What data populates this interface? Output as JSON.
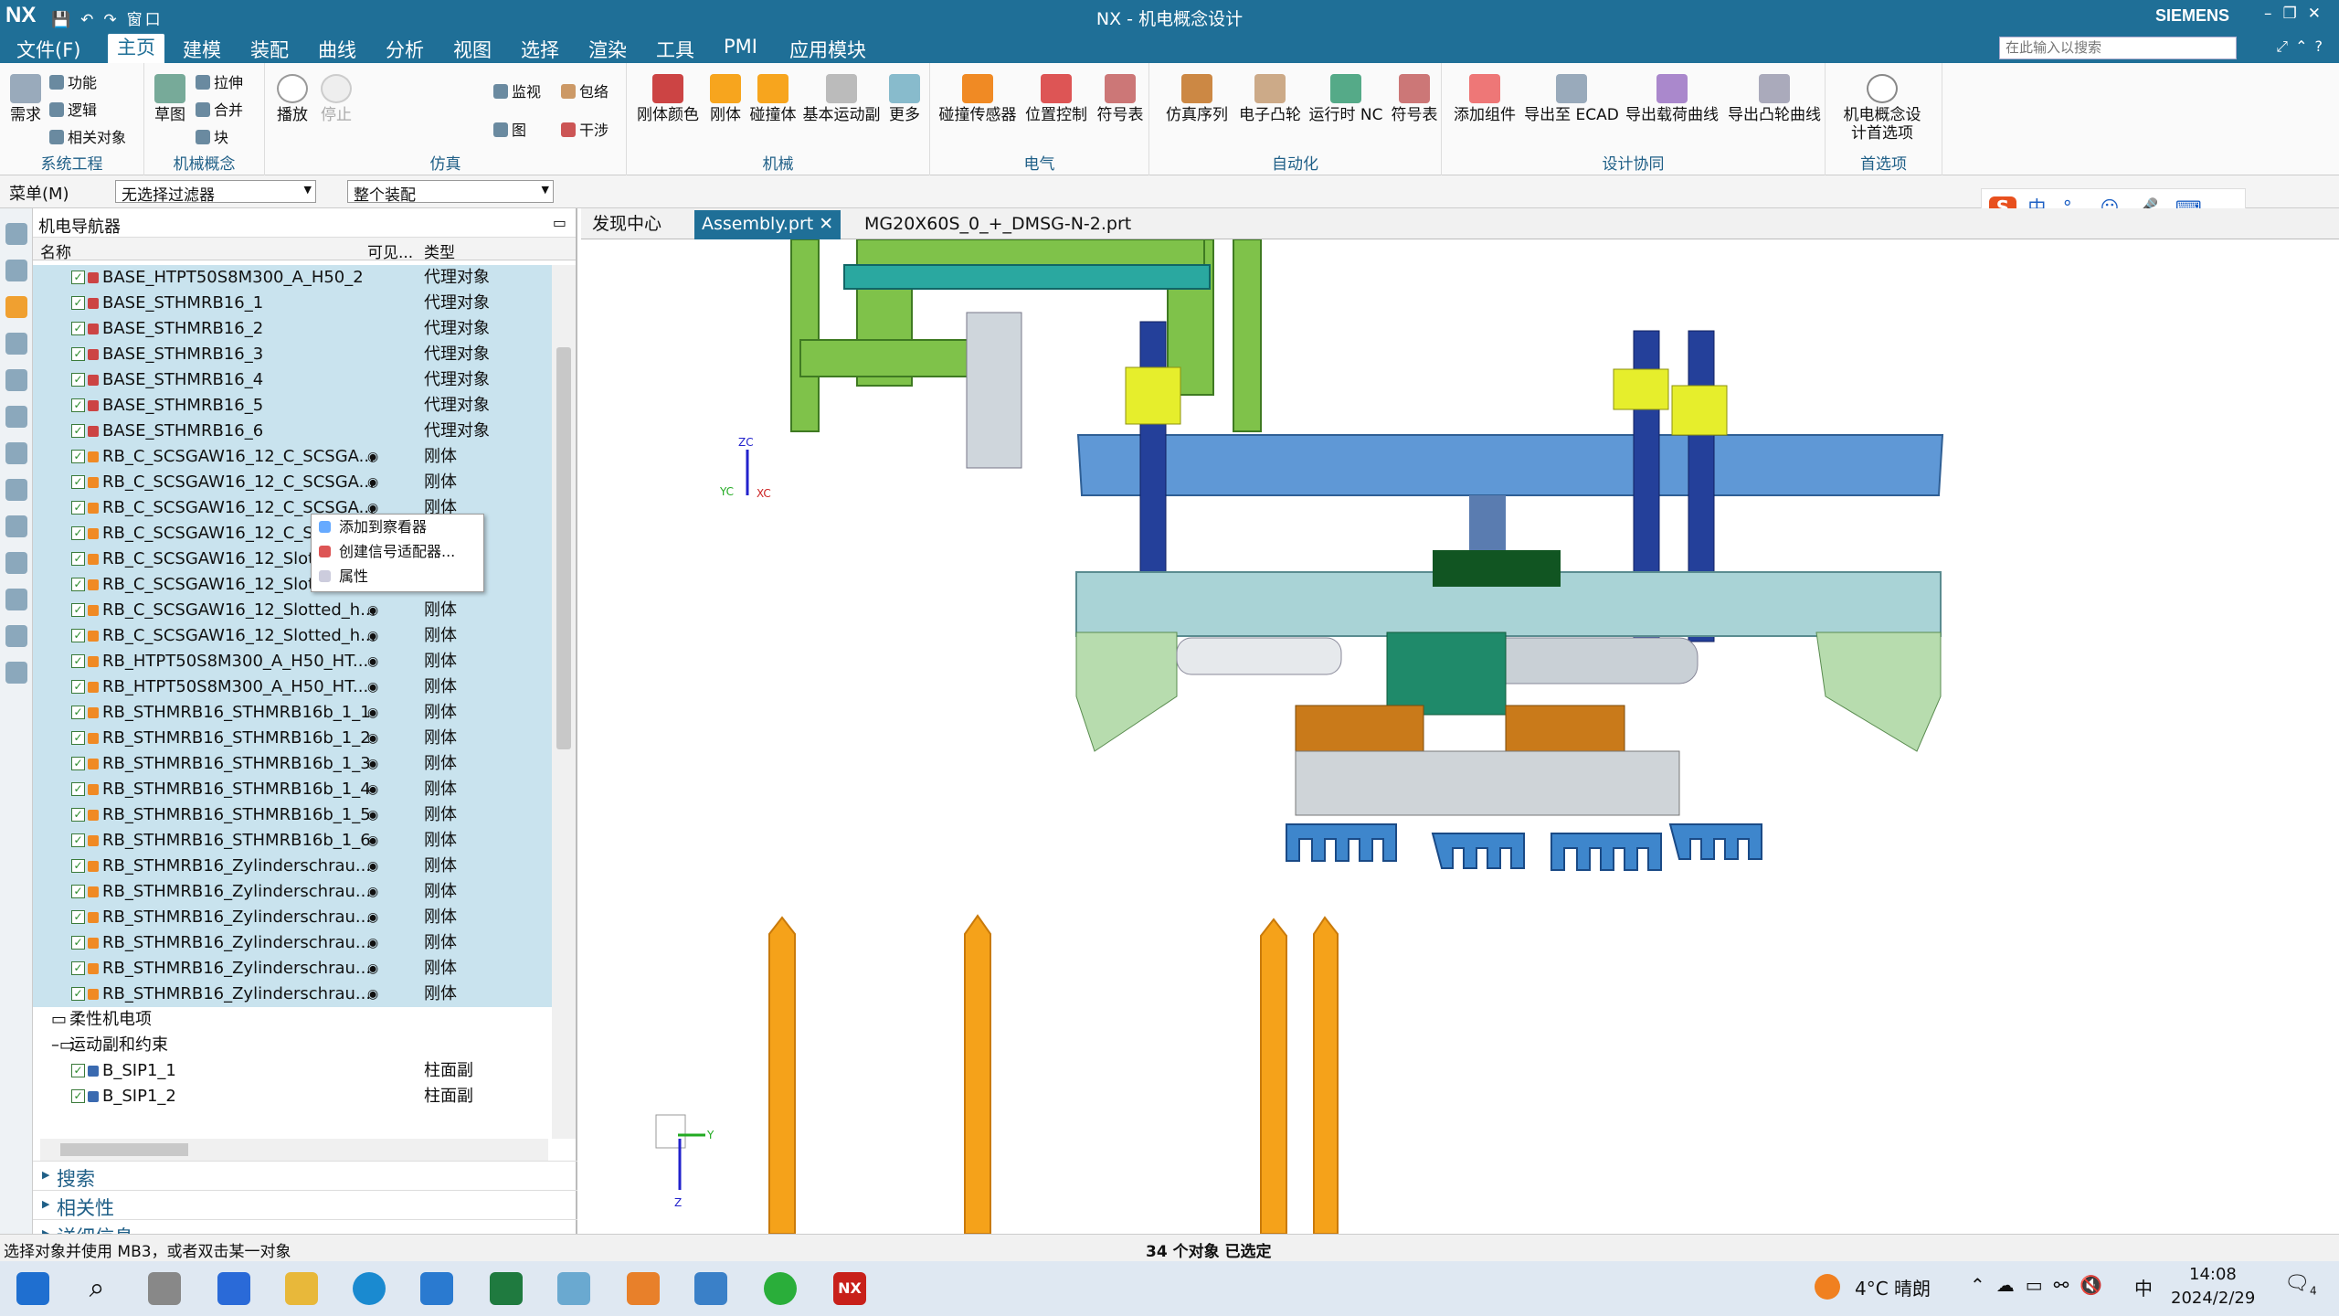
{
  "window": {
    "app_logo": "NX",
    "title": "NX - 机电概念设计",
    "brand": "SIEMENS",
    "quick_access": "窗口"
  },
  "menubar": {
    "items": [
      "文件(F)",
      "主页",
      "建模",
      "装配",
      "曲线",
      "分析",
      "视图",
      "选择",
      "渲染",
      "工具",
      "PMI",
      "应用模块"
    ],
    "active": "主页",
    "search_placeholder": "在此输入以搜索"
  },
  "ribbon": {
    "groups": [
      {
        "label": "系统工程",
        "small": [
          "功能",
          "逻辑",
          "相关对象"
        ],
        "big": [
          "需求"
        ]
      },
      {
        "label": "机械概念",
        "small": [
          "拉伸",
          "合并",
          "块"
        ],
        "big": [
          "草图"
        ]
      },
      {
        "label": "仿真",
        "small": [
          "监视",
          "包络",
          "图",
          "干涉"
        ],
        "big": [
          "播放",
          "停止"
        ]
      },
      {
        "label": "机械",
        "big": [
          "刚体颜色",
          "刚体",
          "碰撞体",
          "基本运动副",
          "更多"
        ]
      },
      {
        "label": "电气",
        "big": [
          "碰撞传感器",
          "位置控制",
          "符号表"
        ]
      },
      {
        "label": "自动化",
        "big": [
          "仿真序列",
          "电子凸轮",
          "运行时 NC",
          "符号表"
        ]
      },
      {
        "label": "设计协同",
        "big": [
          "添加组件",
          "导出至 ECAD",
          "导出载荷曲线",
          "导出凸轮曲线"
        ]
      },
      {
        "label": "首选项",
        "big": [
          "机电概念设计首选项"
        ]
      }
    ]
  },
  "toolbar2": {
    "menu": "菜单(M)",
    "filter": "无选择过滤器",
    "scope": "整个装配"
  },
  "sogou": {
    "items": [
      "中",
      "°,",
      "☺",
      "🎤",
      "⌨"
    ]
  },
  "navigator": {
    "title": "机电导航器",
    "columns": {
      "name": "名称",
      "visible": "可见...",
      "type": "类型"
    },
    "rows": [
      {
        "name": "BASE_HTPT50S8M300_A_H50_2",
        "type": "代理对象",
        "kind": "proxy",
        "sel": true
      },
      {
        "name": "BASE_STHMRB16_1",
        "type": "代理对象",
        "kind": "proxy",
        "sel": true
      },
      {
        "name": "BASE_STHMRB16_2",
        "type": "代理对象",
        "kind": "proxy",
        "sel": true
      },
      {
        "name": "BASE_STHMRB16_3",
        "type": "代理对象",
        "kind": "proxy",
        "sel": true
      },
      {
        "name": "BASE_STHMRB16_4",
        "type": "代理对象",
        "kind": "proxy",
        "sel": true
      },
      {
        "name": "BASE_STHMRB16_5",
        "type": "代理对象",
        "kind": "proxy",
        "sel": true
      },
      {
        "name": "BASE_STHMRB16_6",
        "type": "代理对象",
        "kind": "proxy",
        "sel": true
      },
      {
        "name": "RB_C_SCSGAW16_12_C_SCSGA...",
        "type": "刚体",
        "kind": "rigid",
        "sel": true,
        "vis": true
      },
      {
        "name": "RB_C_SCSGAW16_12_C_SCSGA...",
        "type": "刚体",
        "kind": "rigid",
        "sel": true,
        "vis": true
      },
      {
        "name": "RB_C_SCSGAW16_12_C_SCSGA...",
        "type": "刚体",
        "kind": "rigid",
        "sel": true,
        "vis": true
      },
      {
        "name": "RB_C_SCSGAW16_12_C_SC",
        "type": "",
        "kind": "rigid",
        "sel": true
      },
      {
        "name": "RB_C_SCSGAW16_12_Slott",
        "type": "",
        "kind": "rigid",
        "sel": true
      },
      {
        "name": "RB_C_SCSGAW16_12_Slott",
        "type": "",
        "kind": "rigid",
        "sel": true
      },
      {
        "name": "RB_C_SCSGAW16_12_Slotted_h...",
        "type": "刚体",
        "kind": "rigid",
        "sel": true,
        "vis": true
      },
      {
        "name": "RB_C_SCSGAW16_12_Slotted_h...",
        "type": "刚体",
        "kind": "rigid",
        "sel": true,
        "vis": true
      },
      {
        "name": "RB_HTPT50S8M300_A_H50_HT...",
        "type": "刚体",
        "kind": "rigid",
        "sel": true,
        "vis": true
      },
      {
        "name": "RB_HTPT50S8M300_A_H50_HT...",
        "type": "刚体",
        "kind": "rigid",
        "sel": true,
        "vis": true
      },
      {
        "name": "RB_STHMRB16_STHMRB16b_1_1",
        "type": "刚体",
        "kind": "rigid",
        "sel": true,
        "vis": true
      },
      {
        "name": "RB_STHMRB16_STHMRB16b_1_2",
        "type": "刚体",
        "kind": "rigid",
        "sel": true,
        "vis": true
      },
      {
        "name": "RB_STHMRB16_STHMRB16b_1_3",
        "type": "刚体",
        "kind": "rigid",
        "sel": true,
        "vis": true
      },
      {
        "name": "RB_STHMRB16_STHMRB16b_1_4",
        "type": "刚体",
        "kind": "rigid",
        "sel": true,
        "vis": true
      },
      {
        "name": "RB_STHMRB16_STHMRB16b_1_5",
        "type": "刚体",
        "kind": "rigid",
        "sel": true,
        "vis": true
      },
      {
        "name": "RB_STHMRB16_STHMRB16b_1_6",
        "type": "刚体",
        "kind": "rigid",
        "sel": true,
        "vis": true
      },
      {
        "name": "RB_STHMRB16_Zylinderschrau...",
        "type": "刚体",
        "kind": "rigid",
        "sel": true,
        "vis": true
      },
      {
        "name": "RB_STHMRB16_Zylinderschrau...",
        "type": "刚体",
        "kind": "rigid",
        "sel": true,
        "vis": true
      },
      {
        "name": "RB_STHMRB16_Zylinderschrau...",
        "type": "刚体",
        "kind": "rigid",
        "sel": true,
        "vis": true
      },
      {
        "name": "RB_STHMRB16_Zylinderschrau...",
        "type": "刚体",
        "kind": "rigid",
        "sel": true,
        "vis": true
      },
      {
        "name": "RB_STHMRB16_Zylinderschrau...",
        "type": "刚体",
        "kind": "rigid",
        "sel": true,
        "vis": true
      },
      {
        "name": "RB_STHMRB16_Zylinderschrau...",
        "type": "刚体",
        "kind": "rigid",
        "sel": true,
        "vis": true
      },
      {
        "name": "柔性机电项",
        "type": "",
        "kind": "folder",
        "sel": false
      },
      {
        "name": "运动副和约束",
        "type": "",
        "kind": "folder-open",
        "sel": false
      },
      {
        "name": "B_SIP1_1",
        "type": "柱面副",
        "kind": "joint",
        "sel": false
      },
      {
        "name": "B_SIP1_2",
        "type": "柱面副",
        "kind": "joint",
        "sel": false
      }
    ],
    "panels": [
      "搜索",
      "相关性",
      "详细信息"
    ]
  },
  "context_menu": {
    "items": [
      "添加到察看器",
      "创建信号适配器...",
      "属性"
    ]
  },
  "tabs": [
    {
      "label": "发现中心",
      "active": false
    },
    {
      "label": "Assembly.prt",
      "active": true
    },
    {
      "label": "MG20X60S_0_+_DMSG-N-2.prt",
      "active": false
    }
  ],
  "viewport": {
    "axis_labels": [
      "ZC",
      "YC",
      "XC"
    ],
    "triad_labels": [
      "Y",
      "Z"
    ]
  },
  "statusbar": {
    "left": "选择对象并使用 MB3，或者双击某一对象",
    "center": "34 个对象 已选定"
  },
  "taskbar": {
    "weather": "4°C 晴朗",
    "ime": "中",
    "time": "14:08",
    "date": "2024/2/29",
    "notifications": "4"
  },
  "colors": {
    "accent": "#1f6f97",
    "selection": "#c9e3ee",
    "plate_blue": "#5f98d6",
    "frame_green": "#7fc24a",
    "pin_orange": "#f5a21a"
  }
}
